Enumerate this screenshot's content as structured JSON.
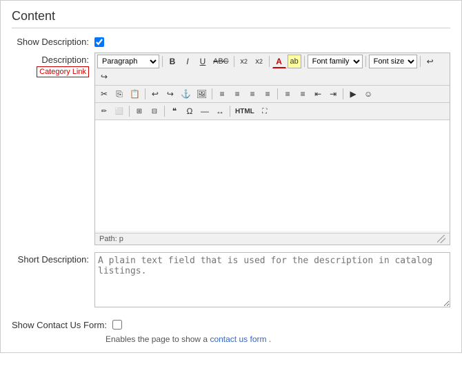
{
  "page": {
    "title": "Content"
  },
  "show_description": {
    "label": "Show Description:",
    "checked": true
  },
  "description": {
    "label": "Description:",
    "category_link": "Category Link",
    "toolbar": {
      "format_select": "Paragraph",
      "font_family_select": "Font family",
      "font_size_select": "Font size",
      "bold": "B",
      "italic": "I",
      "underline": "U",
      "strikethrough": "ABC",
      "subscript": "x₂",
      "superscript": "x²",
      "font_color": "A",
      "marker": "ab",
      "undo": "↩",
      "redo": "↪"
    },
    "path_label": "Path:",
    "path_value": "p"
  },
  "short_description": {
    "label": "Short Description:",
    "placeholder": "A plain text field that is used for the description in catalog listings."
  },
  "show_contact_form": {
    "label": "Show Contact Us Form:",
    "checked": false,
    "help_text": "Enables the page to show a",
    "help_link_text": "contact us form",
    "help_text_after": "."
  }
}
